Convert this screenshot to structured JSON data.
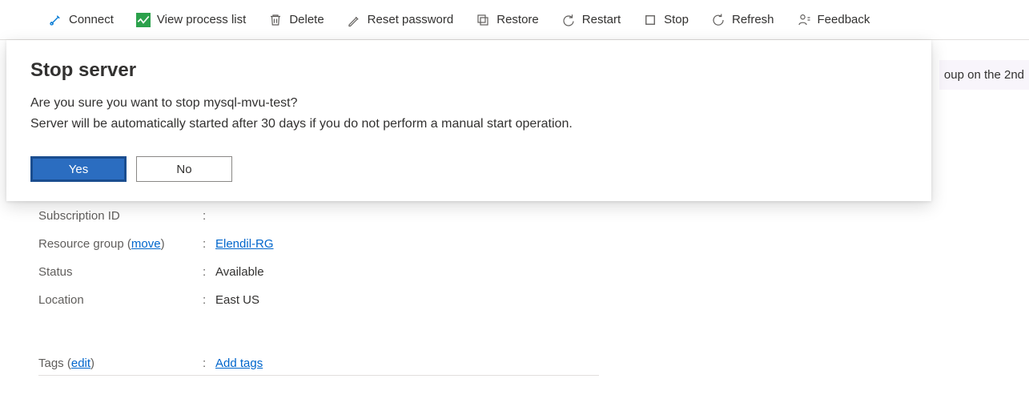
{
  "toolbar": {
    "connect": "Connect",
    "view_process_list": "View process list",
    "delete": "Delete",
    "reset_password": "Reset password",
    "restore": "Restore",
    "restart": "Restart",
    "stop": "Stop",
    "refresh": "Refresh",
    "feedback": "Feedback"
  },
  "banner_fragment": "oup on the 2nd",
  "dialog": {
    "title": "Stop server",
    "line1": "Are you sure you want to stop mysql-mvu-test?",
    "line2": "Server will be automatically started after 30 days if you do not perform a manual start operation.",
    "yes": "Yes",
    "no": "No"
  },
  "details": {
    "subscription_id_label": "Subscription ID",
    "subscription_id_value": "",
    "resource_group_label_prefix": "Resource group (",
    "resource_group_move": "move",
    "resource_group_label_suffix": ")",
    "resource_group_value": "Elendil-RG",
    "status_label": "Status",
    "status_value": "Available",
    "location_label": "Location",
    "location_value": "East US",
    "tags_label_prefix": "Tags (",
    "tags_edit": "edit",
    "tags_label_suffix": ")",
    "tags_value": "Add tags"
  }
}
